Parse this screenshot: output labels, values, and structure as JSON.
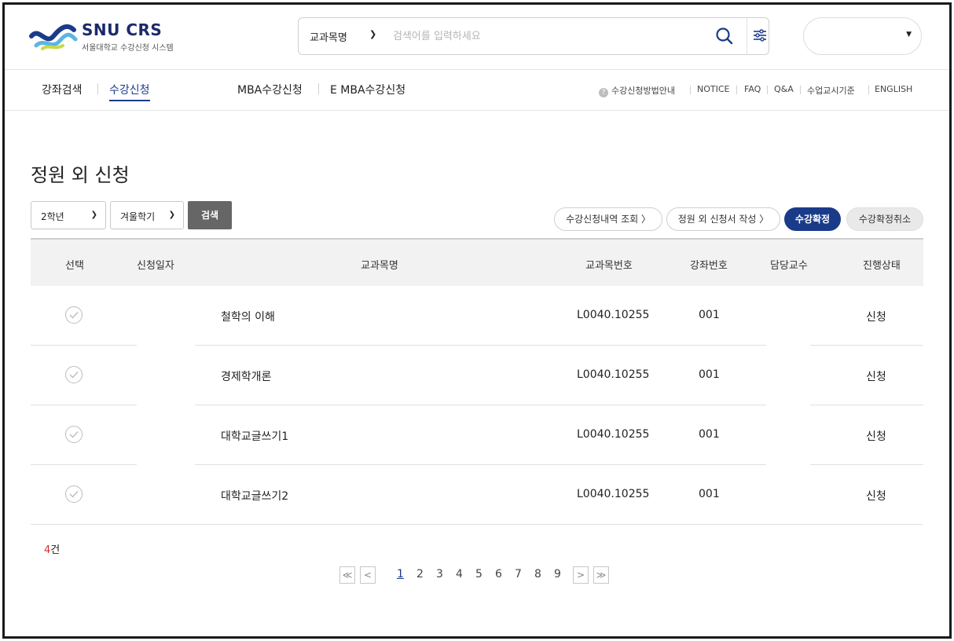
{
  "brand": {
    "title": "SNU CRS",
    "subtitle": "서울대학교 수강신청 시스템"
  },
  "search": {
    "category": "교과목명",
    "placeholder": "검색어를 입력하세요"
  },
  "nav": {
    "left": [
      "강좌검색",
      "수강신청",
      "MBA수강신청",
      "E MBA수강신청"
    ],
    "active_index": 1,
    "util": [
      "수강신청방법안내",
      "NOTICE",
      "FAQ",
      "Q&A",
      "수업교시기준",
      "ENGLISH"
    ]
  },
  "page": {
    "title": "정원 외 신청"
  },
  "filters": {
    "grade": "2학년",
    "term": "겨울학기",
    "search_button": "검색"
  },
  "actions": [
    "수강신청내역 조회 〉",
    "정원 외 신청서 작성 〉",
    "수강확정",
    "수강확정취소"
  ],
  "table": {
    "headers": [
      "선택",
      "신청일자",
      "교과목명",
      "교과목번호",
      "강좌번호",
      "담당교수",
      "진행상태"
    ],
    "rows": [
      {
        "course": "철학의 이해",
        "code": "L0040.10255",
        "section": "001",
        "status": "신청"
      },
      {
        "course": "경제학개론",
        "code": "L0040.10255",
        "section": "001",
        "status": "신청"
      },
      {
        "course": "대학교글쓰기1",
        "code": "L0040.10255",
        "section": "001",
        "status": "신청"
      },
      {
        "course": "대학교글쓰기2",
        "code": "L0040.10255",
        "section": "001",
        "status": "신청"
      }
    ]
  },
  "count": {
    "value": "4",
    "unit": "건"
  },
  "pagination": {
    "first": "≪",
    "prev": "<",
    "next": ">",
    "last": "≫",
    "pages": [
      "1",
      "2",
      "3",
      "4",
      "5",
      "6",
      "7",
      "8",
      "9"
    ],
    "current": "1"
  },
  "colors": {
    "primary": "#1a3b8a",
    "count_red": "#d0312d",
    "search_btn": "#666666"
  }
}
